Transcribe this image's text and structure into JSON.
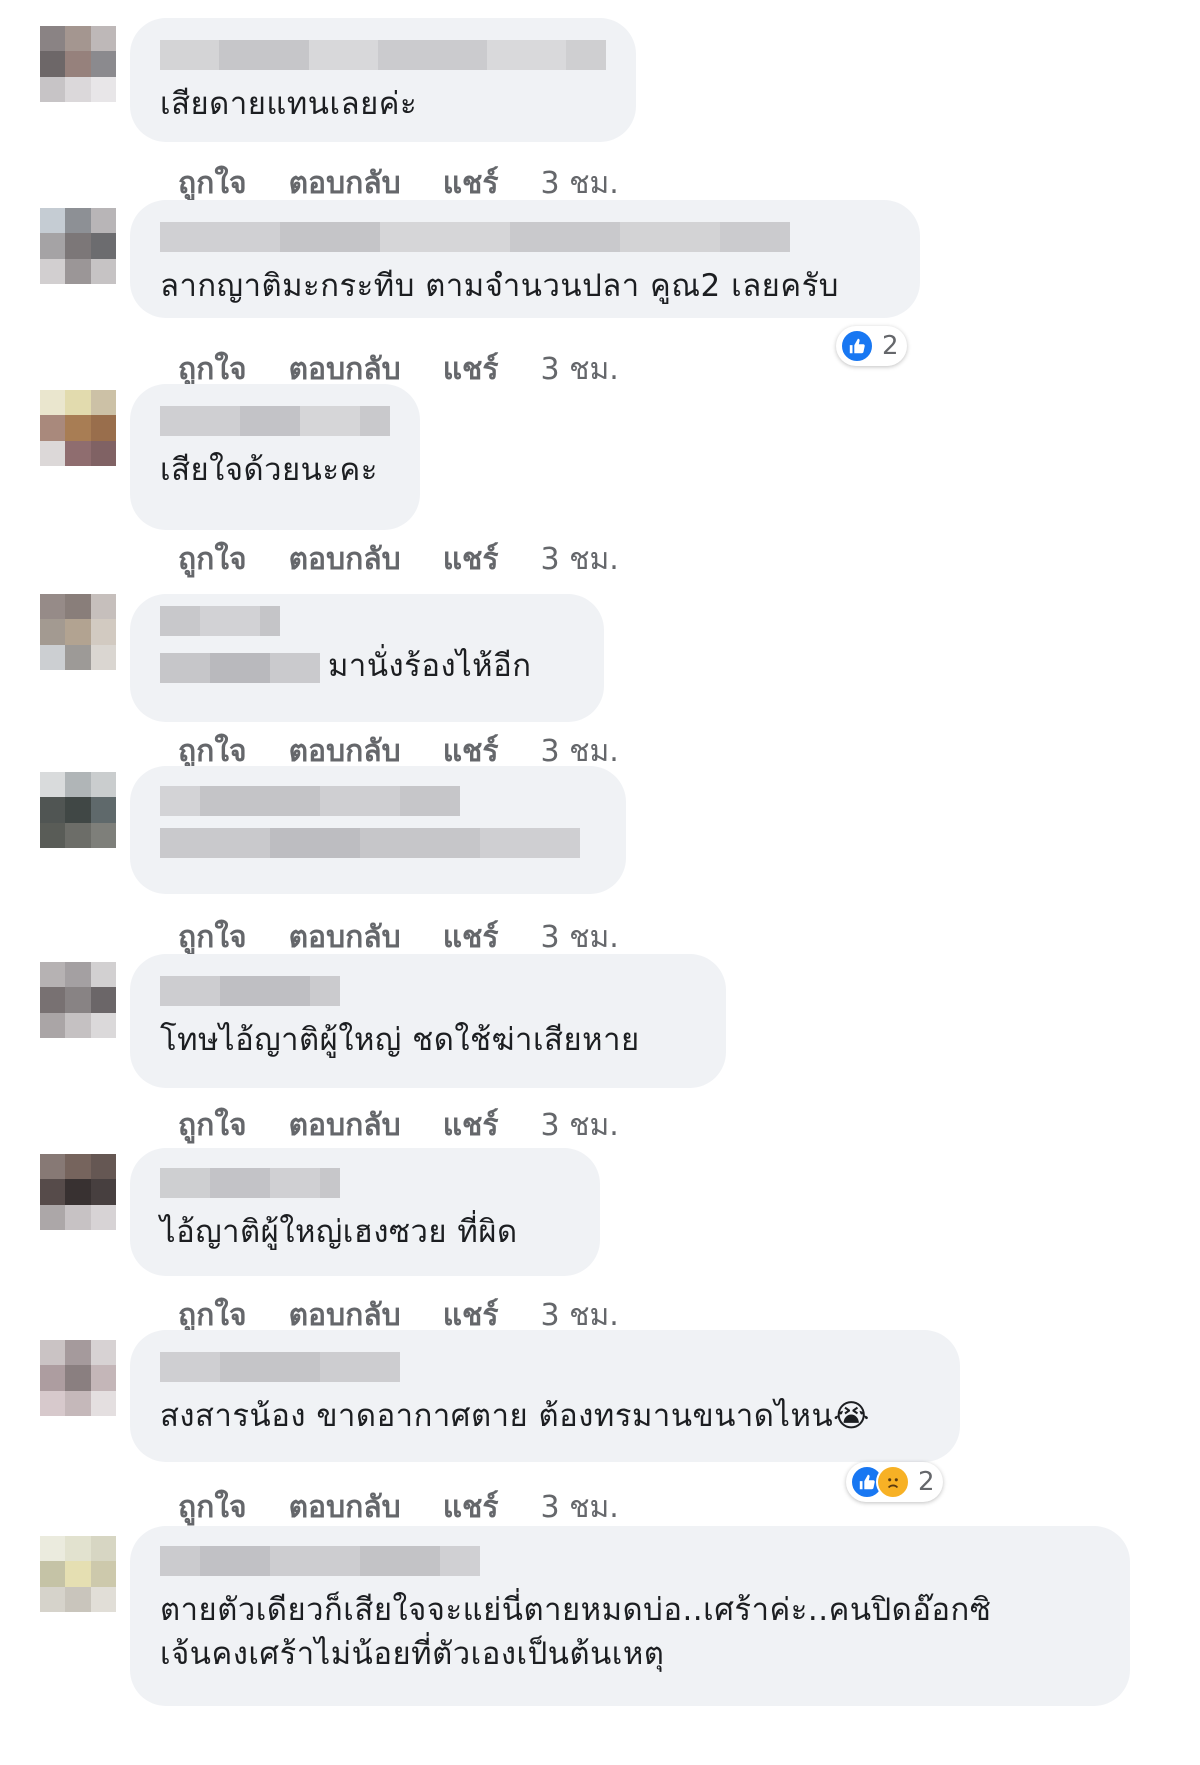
{
  "actions": {
    "like": "ถูกใจ",
    "reply": "ตอบกลับ",
    "share": "แชร์",
    "time": "3 ชม."
  },
  "comments": [
    {
      "text": "เสียดายแทนเลยค่ะ"
    },
    {
      "text": "ลากญาติมะกระทีบ ตามจำนวนปลา คูณ2 เลยครับ",
      "reactions": {
        "icons": [
          "like-icon"
        ],
        "count": "2"
      }
    },
    {
      "text": "เสียใจด้วยนะคะ"
    },
    {
      "text": "มานั่งร้องไห้อีก"
    },
    {
      "text": ""
    },
    {
      "text": "โทษไอ้ญาติผู้ใหญ่ ชดใช้ฆ่าเสียหาย"
    },
    {
      "text": "ไอ้ญาติผู้ใหญ่เฮงซวย ที่ผิด"
    },
    {
      "text": "สงสารน้อง ขาดอากาศตาย ต้องทรมานขนาดไหน😭",
      "reactions": {
        "icons": [
          "like-icon",
          "sad-icon"
        ],
        "count": "2"
      }
    },
    {
      "text": "ตายตัวเดียวก็เสียใจจะแย่นี่ตายหมดบ่อ..เศร้าค่ะ..คนปิดอ๊อกซิ",
      "text2": "เจ้นคงเศร้าไม่น้อยที่ตัวเองเป็นต้นเหตุ"
    }
  ],
  "colors": {
    "like": "#1877f2",
    "sad": "#f7b125",
    "bubble": "#f0f2f5",
    "meta": "#65676b"
  }
}
